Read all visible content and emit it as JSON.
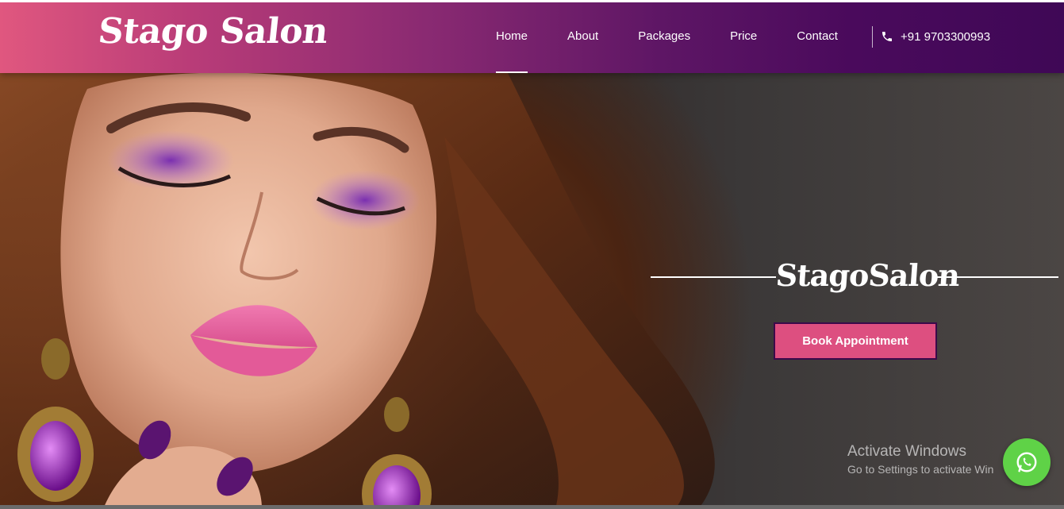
{
  "header": {
    "logo": "Stago Salon",
    "nav": [
      {
        "label": "Home",
        "active": true
      },
      {
        "label": "About",
        "active": false
      },
      {
        "label": "Packages",
        "active": false
      },
      {
        "label": "Price",
        "active": false
      },
      {
        "label": "Contact",
        "active": false
      }
    ],
    "phone": "+91 9703300993",
    "phone_icon": "phone-icon"
  },
  "hero": {
    "title": "StagoSalon",
    "cta_label": "Book Appointment"
  },
  "watermark": {
    "line1": "Activate Windows",
    "line2": "Go to Settings to activate Win"
  },
  "floating": {
    "icon": "whatsapp-icon"
  },
  "colors": {
    "header_start": "#e0577f",
    "header_end": "#3f0856",
    "cta_background": "#dd4f80",
    "cta_border": "#3b0a4a",
    "whatsapp_green": "#5fd247"
  }
}
